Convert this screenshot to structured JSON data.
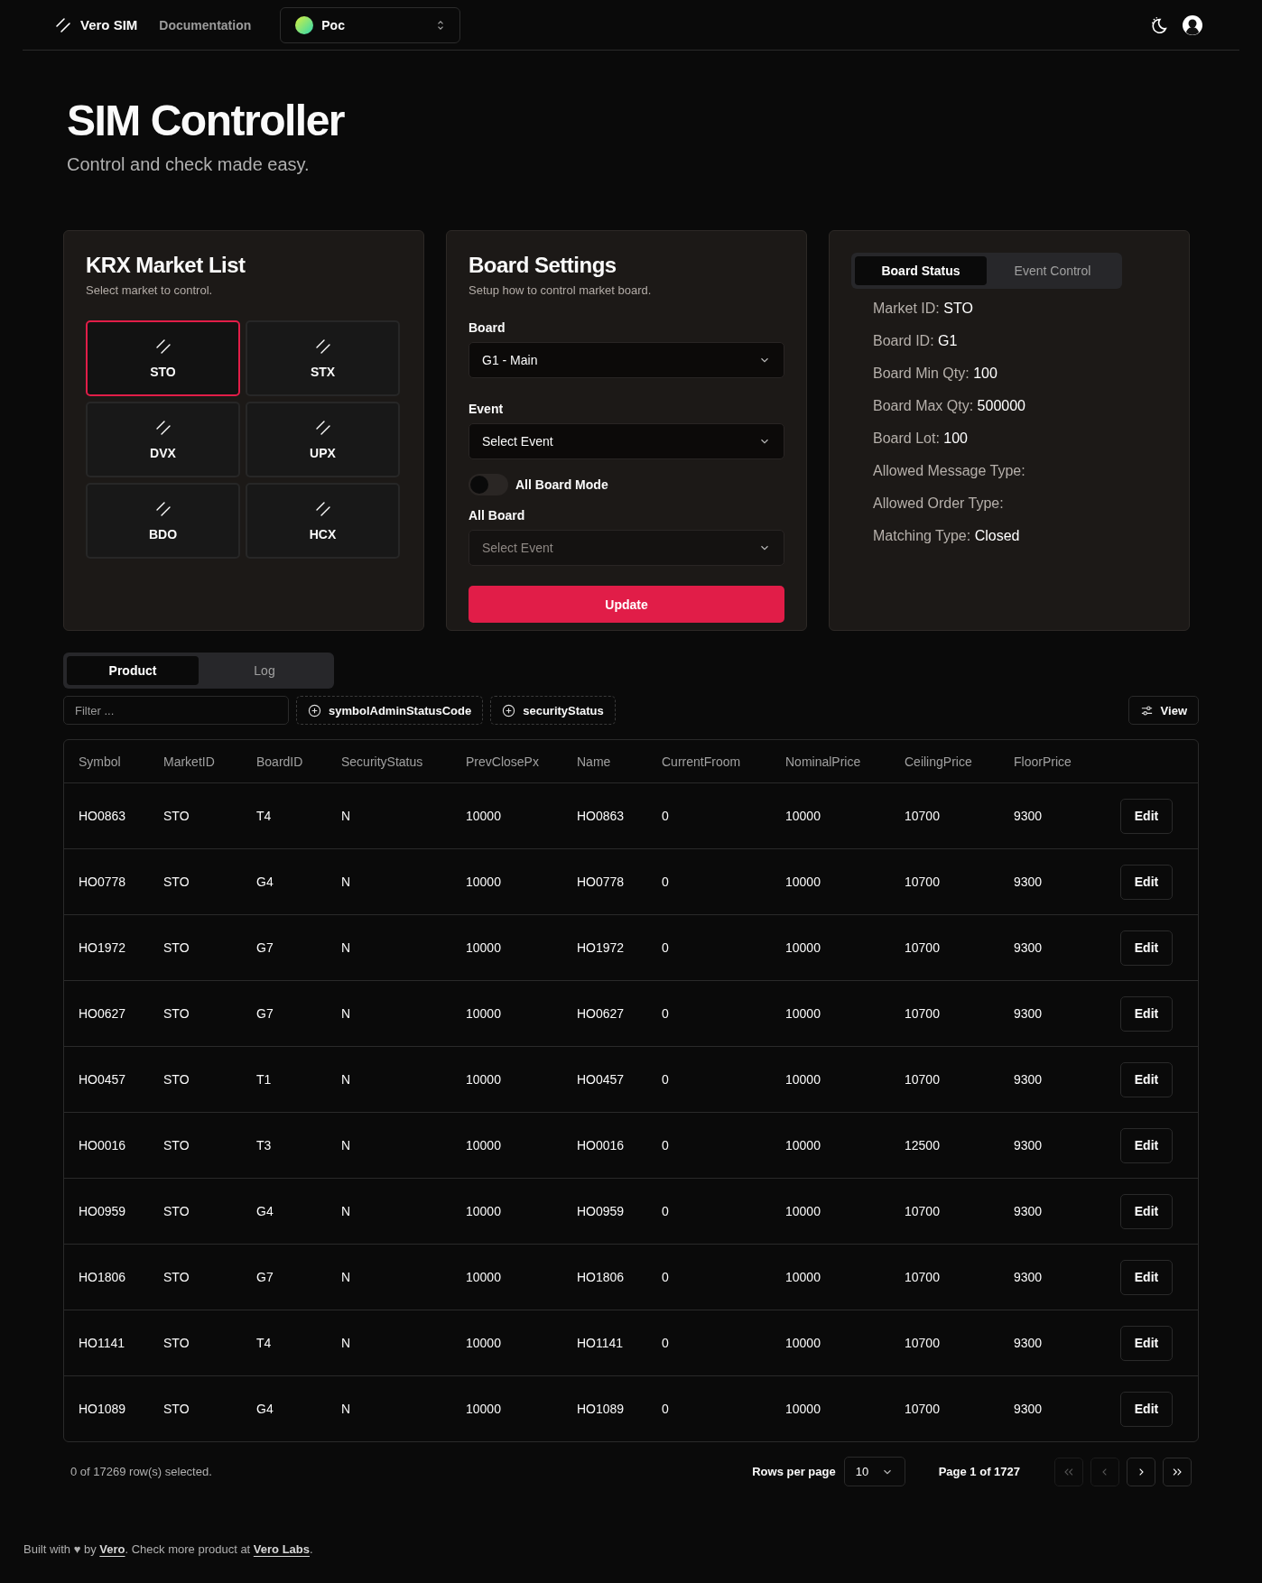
{
  "header": {
    "brand": "Vero SIM",
    "nav": [
      {
        "label": "Documentation"
      }
    ],
    "project": {
      "name": "Poc"
    }
  },
  "hero": {
    "title": "SIM Controller",
    "subtitle": "Control and check made easy."
  },
  "market_list": {
    "title": "KRX Market List",
    "subtitle": "Select market to control.",
    "markets": [
      {
        "name": "STO",
        "selected": true
      },
      {
        "name": "STX",
        "selected": false
      },
      {
        "name": "DVX",
        "selected": false
      },
      {
        "name": "UPX",
        "selected": false
      },
      {
        "name": "BDO",
        "selected": false
      },
      {
        "name": "HCX",
        "selected": false
      }
    ]
  },
  "board_settings": {
    "title": "Board Settings",
    "subtitle": "Setup how to control market board.",
    "board": {
      "label": "Board",
      "value": "G1 - Main"
    },
    "event": {
      "label": "Event",
      "value": "Select Event"
    },
    "all_board_mode": {
      "label": "All Board Mode",
      "checked": false
    },
    "all_board": {
      "label": "All Board",
      "value": "Select Event",
      "disabled": true
    },
    "button": "Update"
  },
  "status_panel": {
    "tabs": [
      {
        "label": "Board Status",
        "selected": true
      },
      {
        "label": "Event Control",
        "selected": false
      }
    ],
    "lines": [
      {
        "label": "Market ID:",
        "value": "STO"
      },
      {
        "label": "Board ID:",
        "value": "G1"
      },
      {
        "label": "Board Min Qty:",
        "value": "100"
      },
      {
        "label": "Board Max Qty:",
        "value": "500000"
      },
      {
        "label": "Board Lot:",
        "value": "100"
      },
      {
        "label": "Allowed Message Type:"
      },
      {
        "label": "Allowed Order Type:"
      },
      {
        "label": "Matching Type:",
        "value": "Closed"
      }
    ]
  },
  "data_tabs": [
    {
      "label": "Product",
      "selected": true
    },
    {
      "label": "Log",
      "selected": false
    }
  ],
  "toolbar": {
    "filter_placeholder": "Filter ...",
    "facets": [
      "symbolAdminStatusCode",
      "securityStatus"
    ],
    "view_button": "View"
  },
  "table": {
    "columns": [
      "Symbol",
      "MarketID",
      "BoardID",
      "SecurityStatus",
      "PrevClosePx",
      "Name",
      "CurrentFroom",
      "NominalPrice",
      "CeilingPrice",
      "FloorPrice"
    ],
    "rows": [
      {
        "cells": [
          "HO0863",
          "STO",
          "T4",
          "N",
          "10000",
          "HO0863",
          "0",
          "10000",
          "10700",
          "9300"
        ],
        "action": "Edit"
      },
      {
        "cells": [
          "HO0778",
          "STO",
          "G4",
          "N",
          "10000",
          "HO0778",
          "0",
          "10000",
          "10700",
          "9300"
        ],
        "action": "Edit"
      },
      {
        "cells": [
          "HO1972",
          "STO",
          "G7",
          "N",
          "10000",
          "HO1972",
          "0",
          "10000",
          "10700",
          "9300"
        ],
        "action": "Edit"
      },
      {
        "cells": [
          "HO0627",
          "STO",
          "G7",
          "N",
          "10000",
          "HO0627",
          "0",
          "10000",
          "10700",
          "9300"
        ],
        "action": "Edit"
      },
      {
        "cells": [
          "HO0457",
          "STO",
          "T1",
          "N",
          "10000",
          "HO0457",
          "0",
          "10000",
          "10700",
          "9300"
        ],
        "action": "Edit"
      },
      {
        "cells": [
          "HO0016",
          "STO",
          "T3",
          "N",
          "10000",
          "HO0016",
          "0",
          "10000",
          "12500",
          "9300"
        ],
        "action": "Edit"
      },
      {
        "cells": [
          "HO0959",
          "STO",
          "G4",
          "N",
          "10000",
          "HO0959",
          "0",
          "10000",
          "10700",
          "9300"
        ],
        "action": "Edit"
      },
      {
        "cells": [
          "HO1806",
          "STO",
          "G7",
          "N",
          "10000",
          "HO1806",
          "0",
          "10000",
          "10700",
          "9300"
        ],
        "action": "Edit"
      },
      {
        "cells": [
          "HO1141",
          "STO",
          "T4",
          "N",
          "10000",
          "HO1141",
          "0",
          "10000",
          "10700",
          "9300"
        ],
        "action": "Edit"
      },
      {
        "cells": [
          "HO1089",
          "STO",
          "G4",
          "N",
          "10000",
          "HO1089",
          "0",
          "10000",
          "10700",
          "9300"
        ],
        "action": "Edit"
      }
    ]
  },
  "pagination": {
    "selection": "0 of 17269 row(s) selected.",
    "rows_per_page_label": "Rows per page",
    "rows_per_page": "10",
    "page": "Page 1 of 1727",
    "buttons": [
      {
        "kind": "first",
        "disabled": true
      },
      {
        "kind": "prev",
        "disabled": true
      },
      {
        "kind": "next",
        "disabled": false
      },
      {
        "kind": "last",
        "disabled": false
      }
    ]
  },
  "footer": {
    "parts": [
      {
        "kind": "text",
        "text": "Built with ♥ by "
      },
      {
        "kind": "link",
        "text": "Vero"
      },
      {
        "kind": "text",
        "text": ". Check more product at "
      },
      {
        "kind": "link",
        "text": "Vero Labs"
      },
      {
        "kind": "text",
        "text": "."
      }
    ]
  }
}
